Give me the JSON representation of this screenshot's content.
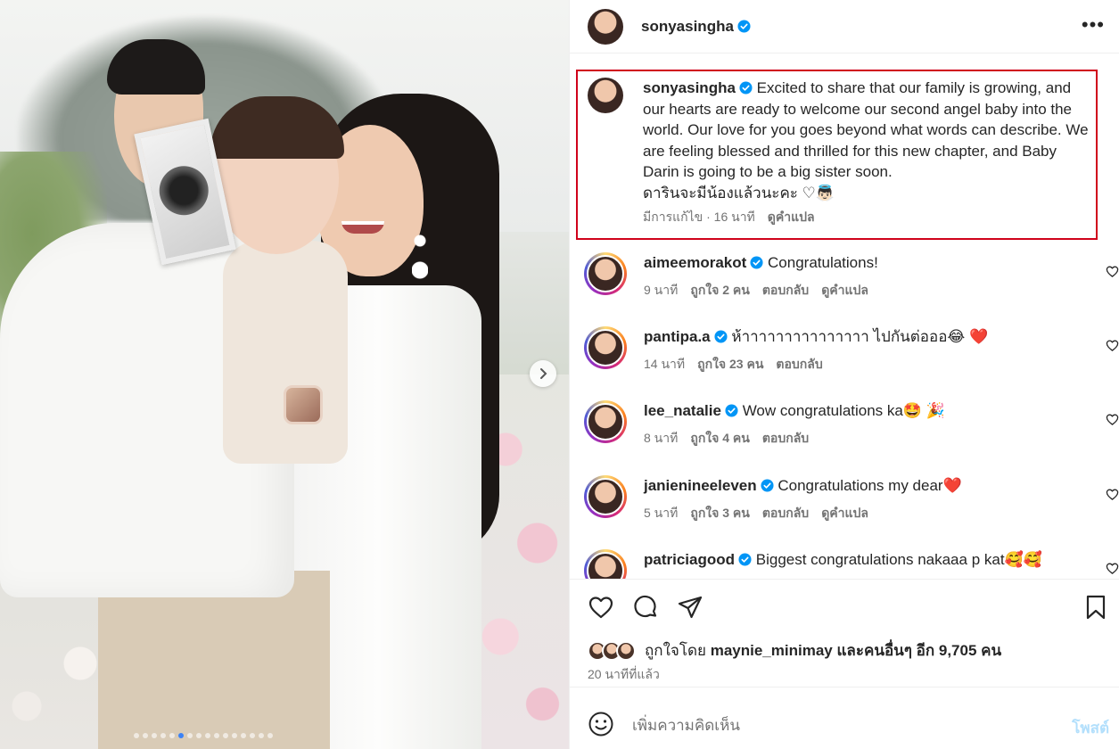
{
  "post": {
    "author": "sonyasingha",
    "more_icon": "more-horizontal-icon"
  },
  "caption": {
    "username": "sonyasingha",
    "text_en": "Excited to share that our family is growing, and our hearts are ready to welcome our second angel baby into the world. Our love for you goes beyond what words can describe. We are feeling blessed and thrilled for this new chapter, and Baby Darin is going to be a big sister soon.",
    "text_th": "ดารินจะมีน้องแล้วนะคะ ♡👼🏻",
    "edited": "มีการแก้ไข",
    "time": "16 นาที",
    "translate": "ดูคำแปล"
  },
  "comments": [
    {
      "username": "aimeemorakot",
      "text": "Congratulations!",
      "time": "9 นาที",
      "likes": "ถูกใจ 2 คน",
      "reply": "ตอบกลับ",
      "translate": "ดูคำแปล"
    },
    {
      "username": "pantipa.a",
      "text": "ห้าาาาาาาาาาาาาาา ไปกันต่อออ😂 ❤️",
      "time": "14 นาที",
      "likes": "ถูกใจ 23 คน",
      "reply": "ตอบกลับ",
      "translate": ""
    },
    {
      "username": "lee_natalie",
      "text": "Wow congratulations ka🤩 🎉",
      "time": "8 นาที",
      "likes": "ถูกใจ 4 คน",
      "reply": "ตอบกลับ",
      "translate": ""
    },
    {
      "username": "janienineeleven",
      "text": "Congratulations my dear❤️",
      "time": "5 นาที",
      "likes": "ถูกใจ 3 คน",
      "reply": "ตอบกลับ",
      "translate": "ดูคำแปล"
    },
    {
      "username": "patriciagood",
      "text": "Biggest congratulations nakaaa p kat🥰🥰",
      "time": "",
      "likes": "",
      "reply": "",
      "translate": ""
    }
  ],
  "actions": {
    "like_icon": "heart-icon",
    "comment_icon": "comment-icon",
    "share_icon": "share-icon",
    "save_icon": "bookmark-icon"
  },
  "likes": {
    "prefix": "ถูกใจโดย",
    "user": "maynie_minimay",
    "suffix": "และคนอื่นๆ อีก 9,705 คน"
  },
  "posted_time": "20 นาทีที่แล้ว",
  "add_comment": {
    "placeholder": "เพิ่มความคิดเห็น",
    "post_label": "โพสต์"
  },
  "carousel": {
    "total_slides": 16,
    "active_slide": 6
  },
  "colors": {
    "verified": "#0095f6",
    "highlight_box": "#d0021b",
    "secondary_text": "#737373",
    "post_button_disabled": "#b2dffc"
  }
}
